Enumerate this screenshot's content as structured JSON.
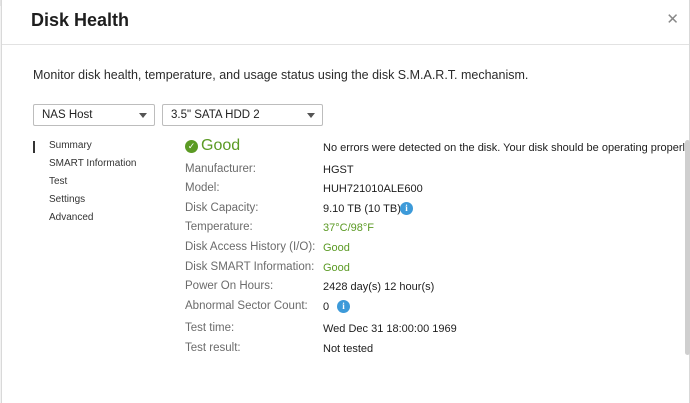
{
  "dialog": {
    "title": "Disk Health",
    "close_glyph": "✕",
    "description": "Monitor disk health, temperature, and usage status using the disk S.M.A.R.T. mechanism."
  },
  "selectors": {
    "host": "NAS Host",
    "disk": "3.5\" SATA HDD 2"
  },
  "nav": {
    "items": [
      "Summary",
      "SMART Information",
      "Test",
      "Settings",
      "Advanced"
    ],
    "active": "Summary"
  },
  "summary": {
    "status": "Good",
    "status_message": "No errors were detected on the disk. Your disk should be operating properly.",
    "rows": [
      {
        "label": "Manufacturer:",
        "value": "HGST"
      },
      {
        "label": "Model:",
        "value": "HUH721010ALE600"
      },
      {
        "label": "Disk Capacity:",
        "value": "9.10 TB (10 TB)"
      },
      {
        "label": "Temperature:",
        "value": "37°C/98°F"
      },
      {
        "label": "Disk Access History (I/O):",
        "value": "Good"
      },
      {
        "label": "Disk SMART Information:",
        "value": "Good"
      },
      {
        "label": "Power On Hours:",
        "value": "2428 day(s) 12 hour(s)"
      },
      {
        "label": "Abnormal Sector Count:",
        "value": "0"
      },
      {
        "label": "Test time:",
        "value": "Wed Dec 31 18:00:00 1969"
      },
      {
        "label": "Test result:",
        "value": "Not tested"
      }
    ]
  },
  "icons": {
    "info_glyph": "i",
    "check_glyph": "✓"
  },
  "colors": {
    "good": "#5b9a24",
    "info": "#3d9ad9"
  }
}
